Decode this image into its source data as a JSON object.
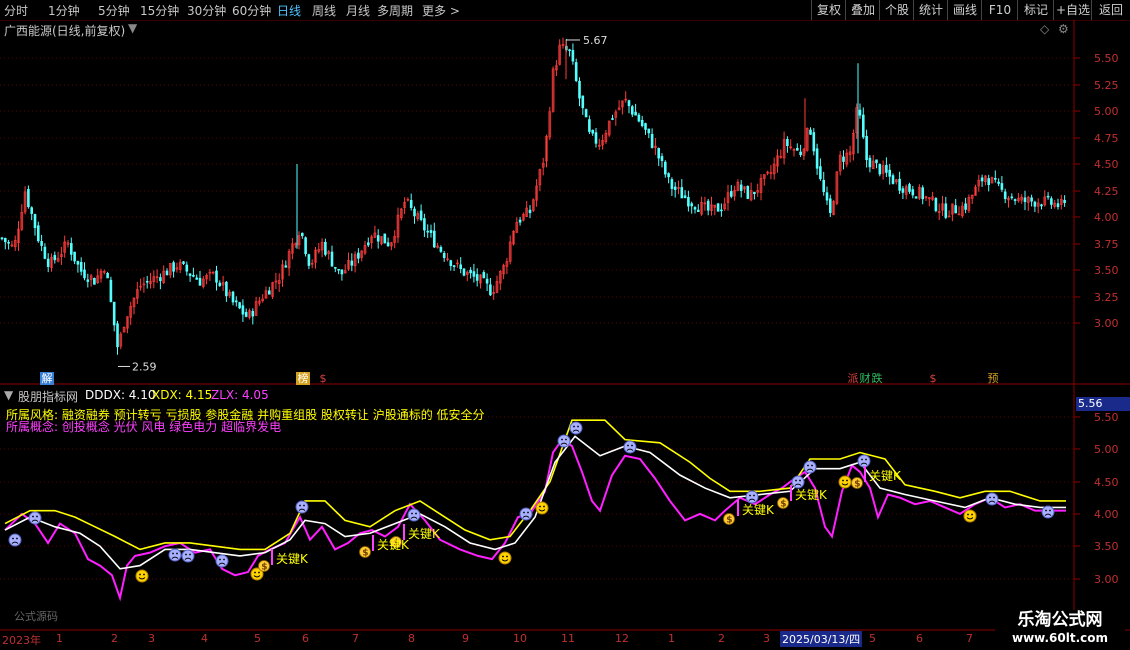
{
  "toolbar": {
    "timeframes": [
      "分时",
      "1分钟",
      "5分钟",
      "15分钟",
      "30分钟",
      "60分钟",
      "日线",
      "周线",
      "月线",
      "多周期",
      "更多 >"
    ],
    "active": "日线",
    "right_buttons": [
      "复权",
      "叠加",
      "个股",
      "统计",
      "画线",
      "F10",
      "标记",
      "+自选",
      "返回"
    ]
  },
  "main_panel": {
    "title": "广西能源(日线,前复权)",
    "high_label": "5.67",
    "low_label": "2.59",
    "y_ticks": [
      "5.50",
      "5.25",
      "5.00",
      "4.75",
      "4.50",
      "4.25",
      "4.00",
      "3.75",
      "3.50",
      "3.25",
      "3.00"
    ],
    "badges": [
      {
        "text": "解",
        "color": "#3a7fd6"
      },
      {
        "text": "榜",
        "color": "#d4a020"
      },
      {
        "text": "$",
        "color": "#e04040"
      },
      {
        "text": "派",
        "color": "#e04040"
      },
      {
        "text": "财",
        "color": "#30c060"
      },
      {
        "text": "跌",
        "color": "#30c060"
      },
      {
        "text": "$",
        "color": "#e04040"
      },
      {
        "text": "预",
        "color": "#d4a020"
      }
    ]
  },
  "indicator_panel": {
    "name": "股朋指标网",
    "dddx_label": "DDDX: 4.10",
    "xdx_label": "XDX: 4.15",
    "zlx_label": "ZLX: 4.05",
    "style_line": "所属风格:  融资融券 预计转亏 亏损股 参股金融 并购重组股 股权转让 沪股通标的 低安全分",
    "concept_line": "所属概念:  创投概念 光伏 风电 绿色电力 超临界发电",
    "current_value": "5.56",
    "y_ticks": [
      "5.50",
      "5.00",
      "4.50",
      "4.00",
      "3.50",
      "3.00"
    ],
    "key_label": "关键K",
    "watermark_small": "公式源码"
  },
  "x_axis": {
    "labels": [
      "2023年",
      "1",
      "2",
      "3",
      "4",
      "5",
      "6",
      "7",
      "8",
      "9",
      "10",
      "11",
      "12",
      "1",
      "2",
      "3",
      "4",
      "5",
      "6",
      "7"
    ],
    "highlight_date": "2025/03/13/四"
  },
  "brand": {
    "name": "乐淘公式网",
    "url": "www.60lt.com"
  },
  "colors": {
    "up": "#ff3c3c",
    "down": "#54ffff",
    "dddx": "#ffffff",
    "xdx": "#ffff00",
    "zlx": "#ff20ff"
  }
}
